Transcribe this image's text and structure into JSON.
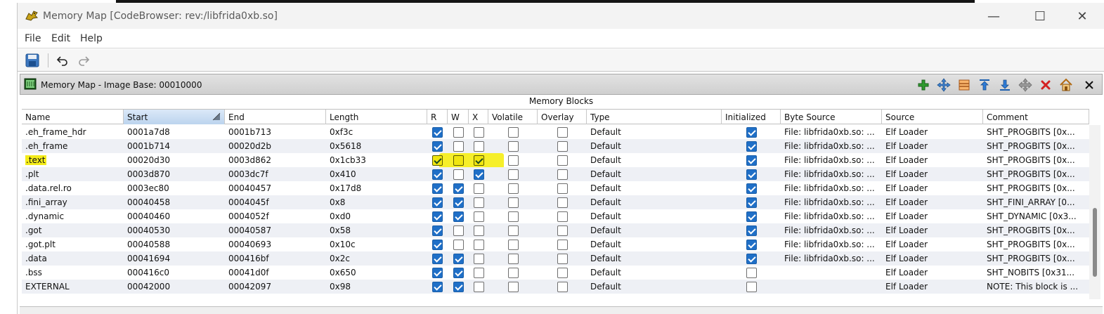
{
  "window": {
    "title": "Memory Map [CodeBrowser: rev:/libfrida0xb.so]",
    "controls": {
      "minimize": "—",
      "maximize": "☐",
      "close": "✕"
    }
  },
  "menu": [
    "File",
    "Edit",
    "Help"
  ],
  "toolbar": {
    "save_icon": "save-icon",
    "undo_icon": "undo-icon",
    "redo_icon": "redo-icon"
  },
  "panel": {
    "title": "Memory Map - Image Base: 00010000",
    "section_title": "Memory Blocks",
    "actions": [
      "add-block",
      "move-block",
      "split-block",
      "expand-up",
      "expand-down",
      "merge-blocks",
      "delete-block",
      "set-image-base",
      "close"
    ]
  },
  "columns": [
    "Name",
    "Start",
    "End",
    "Length",
    "R",
    "W",
    "X",
    "Volatile",
    "Overlay",
    "Type",
    "Initialized",
    "Byte Source",
    "Source",
    "Comment"
  ],
  "sorted_column": "Start",
  "rows": [
    {
      "name": ".eh_frame_hdr",
      "start": "0001a7d8",
      "end": "0001b713",
      "length": "0xf3c",
      "r": true,
      "w": false,
      "x": false,
      "volatile": false,
      "overlay": false,
      "type": "Default",
      "initialized": true,
      "byte_source": "File: libfrida0xb.so: ...",
      "source": "Elf Loader",
      "comment": "SHT_PROGBITS  [0x..."
    },
    {
      "name": ".eh_frame",
      "start": "0001b714",
      "end": "00020d2b",
      "length": "0x5618",
      "r": true,
      "w": false,
      "x": false,
      "volatile": false,
      "overlay": false,
      "type": "Default",
      "initialized": true,
      "byte_source": "File: libfrida0xb.so: ...",
      "source": "Elf Loader",
      "comment": "SHT_PROGBITS  [0x..."
    },
    {
      "name": ".text",
      "start": "00020d30",
      "end": "0003d862",
      "length": "0x1cb33",
      "r": true,
      "w": false,
      "x": true,
      "volatile": false,
      "overlay": false,
      "type": "Default",
      "initialized": true,
      "byte_source": "File: libfrida0xb.so: ...",
      "source": "Elf Loader",
      "comment": "SHT_PROGBITS  [0x...",
      "highlighted": true
    },
    {
      "name": ".plt",
      "start": "0003d870",
      "end": "0003dc7f",
      "length": "0x410",
      "r": true,
      "w": false,
      "x": true,
      "volatile": false,
      "overlay": false,
      "type": "Default",
      "initialized": true,
      "byte_source": "File: libfrida0xb.so: ...",
      "source": "Elf Loader",
      "comment": "SHT_PROGBITS  [0x..."
    },
    {
      "name": ".data.rel.ro",
      "start": "0003ec80",
      "end": "00040457",
      "length": "0x17d8",
      "r": true,
      "w": true,
      "x": false,
      "volatile": false,
      "overlay": false,
      "type": "Default",
      "initialized": true,
      "byte_source": "File: libfrida0xb.so: ...",
      "source": "Elf Loader",
      "comment": "SHT_PROGBITS  [0x..."
    },
    {
      "name": ".fini_array",
      "start": "00040458",
      "end": "0004045f",
      "length": "0x8",
      "r": true,
      "w": true,
      "x": false,
      "volatile": false,
      "overlay": false,
      "type": "Default",
      "initialized": true,
      "byte_source": "File: libfrida0xb.so: ...",
      "source": "Elf Loader",
      "comment": "SHT_FINI_ARRAY  [0..."
    },
    {
      "name": ".dynamic",
      "start": "00040460",
      "end": "0004052f",
      "length": "0xd0",
      "r": true,
      "w": true,
      "x": false,
      "volatile": false,
      "overlay": false,
      "type": "Default",
      "initialized": true,
      "byte_source": "File: libfrida0xb.so: ...",
      "source": "Elf Loader",
      "comment": "SHT_DYNAMIC  [0x3..."
    },
    {
      "name": ".got",
      "start": "00040530",
      "end": "00040587",
      "length": "0x58",
      "r": true,
      "w": false,
      "x": false,
      "volatile": false,
      "overlay": false,
      "type": "Default",
      "initialized": true,
      "byte_source": "File: libfrida0xb.so: ...",
      "source": "Elf Loader",
      "comment": "SHT_PROGBITS  [0x..."
    },
    {
      "name": ".got.plt",
      "start": "00040588",
      "end": "00040693",
      "length": "0x10c",
      "r": true,
      "w": false,
      "x": false,
      "volatile": false,
      "overlay": false,
      "type": "Default",
      "initialized": true,
      "byte_source": "File: libfrida0xb.so: ...",
      "source": "Elf Loader",
      "comment": "SHT_PROGBITS  [0x..."
    },
    {
      "name": ".data",
      "start": "00041694",
      "end": "000416bf",
      "length": "0x2c",
      "r": true,
      "w": true,
      "x": false,
      "volatile": false,
      "overlay": false,
      "type": "Default",
      "initialized": true,
      "byte_source": "File: libfrida0xb.so: ...",
      "source": "Elf Loader",
      "comment": "SHT_PROGBITS  [0x..."
    },
    {
      "name": ".bss",
      "start": "000416c0",
      "end": "00041d0f",
      "length": "0x650",
      "r": true,
      "w": true,
      "x": false,
      "volatile": false,
      "overlay": false,
      "type": "Default",
      "initialized": false,
      "byte_source": "",
      "source": "Elf Loader",
      "comment": "SHT_NOBITS  [0x31..."
    },
    {
      "name": "EXTERNAL",
      "start": "00042000",
      "end": "00042097",
      "length": "0x98",
      "r": true,
      "w": true,
      "x": false,
      "volatile": false,
      "overlay": false,
      "type": "Default",
      "initialized": false,
      "byte_source": "",
      "source": "Elf Loader",
      "comment": "NOTE: This block is ..."
    }
  ],
  "colors": {
    "accent": "#1f6fc7",
    "highlight": "#f4ec1a",
    "row_alt": "#eef0f5"
  }
}
